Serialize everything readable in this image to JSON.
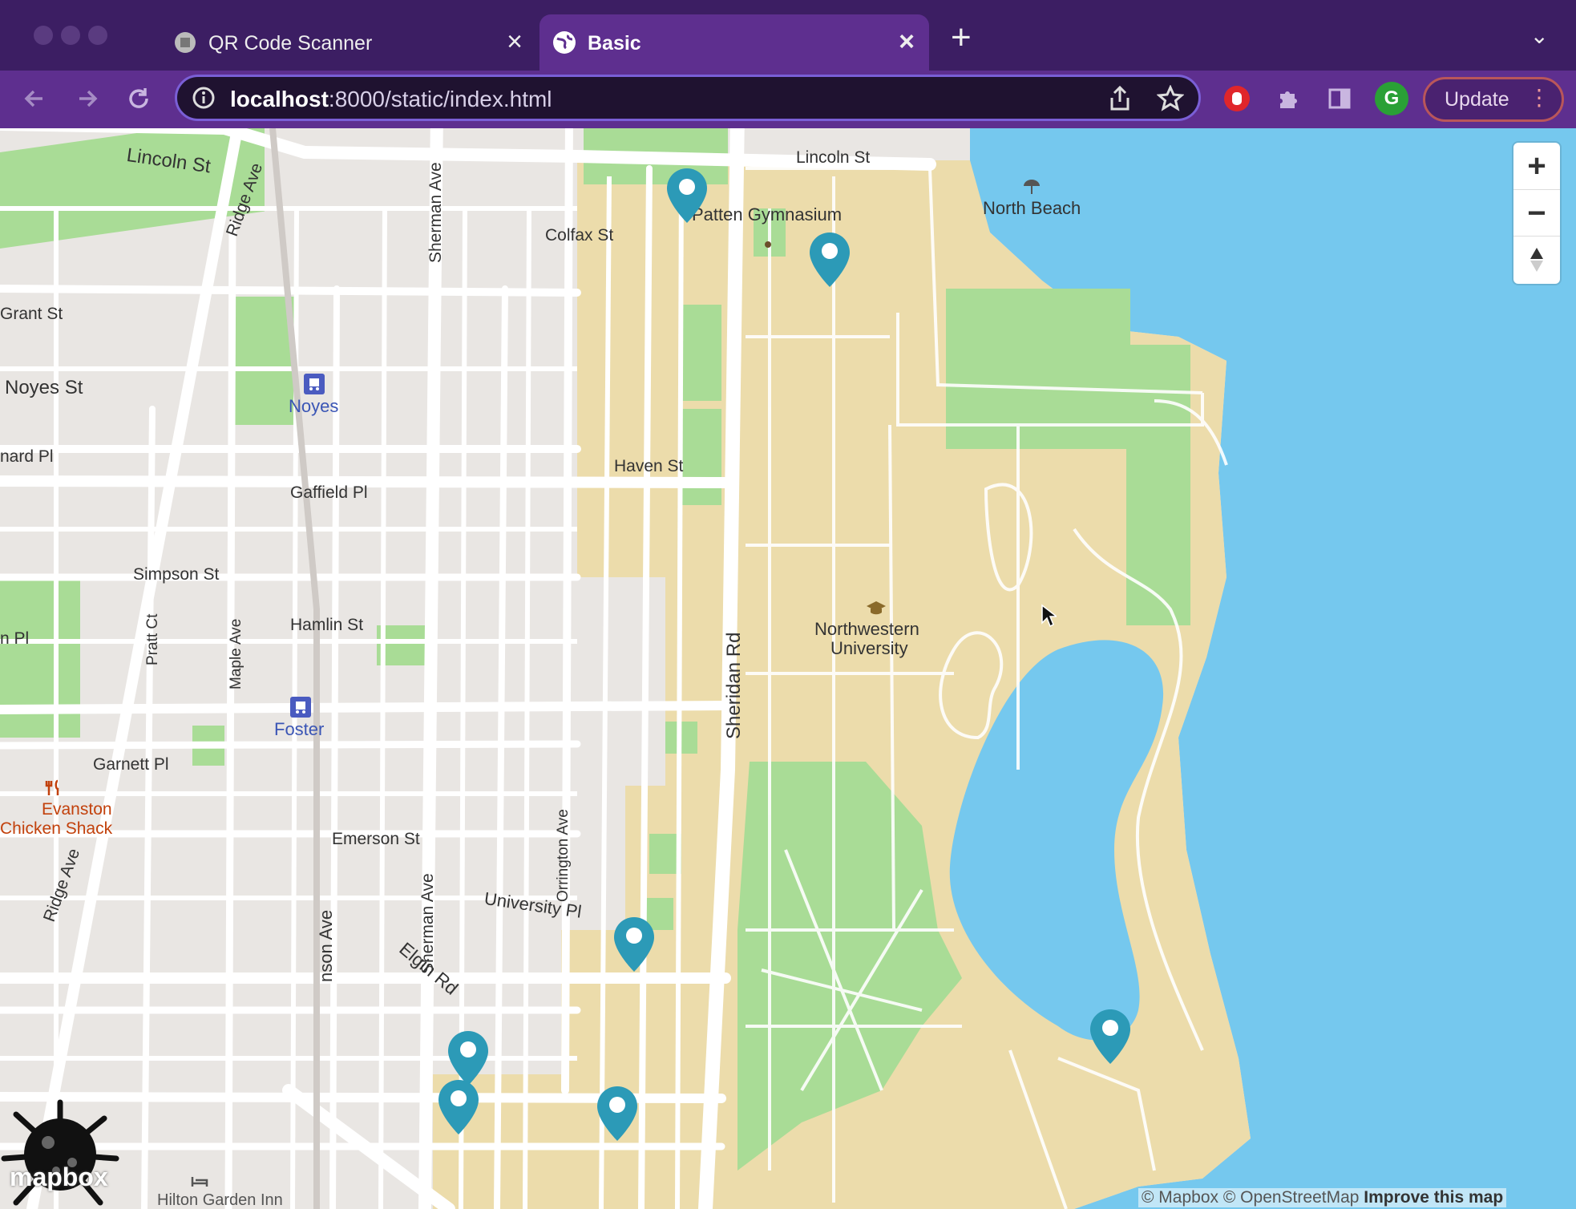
{
  "browser": {
    "tabs": [
      {
        "title": "QR Code Scanner",
        "active": false
      },
      {
        "title": "Basic",
        "active": true
      }
    ],
    "url_host": "localhost",
    "url_path": ":8000/static/index.html",
    "profile_initial": "G",
    "update_label": "Update",
    "accent_color": "#5e2f8f"
  },
  "map": {
    "streets": {
      "lincoln_st_west": "Lincoln St",
      "lincoln_st_east": "Lincoln St",
      "ridge_ave_north": "Ridge Ave",
      "ridge_ave_south": "Ridge Ave",
      "sherman_ave_north": "Sherman Ave",
      "sherman_ave_south": "Sherman Ave",
      "colfax_st": "Colfax St",
      "grant_st": "Grant St",
      "noyes_st": "Noyes St",
      "leonard_pl": "nard Pl",
      "gaffield_pl": "Gaffield Pl",
      "maple_ave": "Maple Ave",
      "haven_st": "Haven St",
      "sheridan_rd": "Sheridan Rd",
      "simpson_st": "Simpson St",
      "hamlin_st": "Hamlin St",
      "pratt_ct": "Pratt Ct",
      "lyons_pl": "n Pl",
      "orrington_ave": "Orrington Ave",
      "garnett_pl": "Garnett Pl",
      "emerson_st": "Emerson St",
      "university_pl": "University Pl",
      "elgin_rd": "Elgin Rd",
      "benson_ave": "nson Ave"
    },
    "places": {
      "patten_gym": "Patten Gymnasium",
      "north_beach": "North Beach",
      "northwestern_1": "Northwestern",
      "northwestern_2": "University",
      "noyes_station": "Noyes",
      "foster_station": "Foster",
      "restaurant_1": "Evanston",
      "restaurant_2": "Chicken Shack",
      "hotel": "Hilton Garden Inn"
    },
    "marker_color": "#2c9ab7",
    "water_color": "#75c8ee",
    "campus_color": "#ecdcab",
    "park_color": "#a9dc96",
    "zoom_in": "+",
    "zoom_out": "−",
    "attribution": {
      "mapbox": "© Mapbox",
      "osm": "© OpenStreetMap",
      "improve": "Improve this map"
    },
    "logo": "mapbox"
  }
}
